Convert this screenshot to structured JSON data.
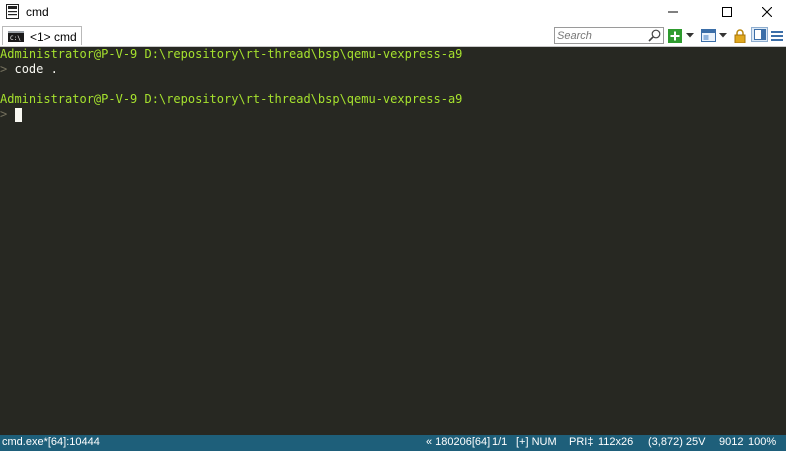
{
  "window": {
    "title": "cmd",
    "icons": {
      "app": "console-app-icon",
      "minimize": "minimize-icon",
      "maximize": "maximize-icon",
      "close": "close-icon"
    }
  },
  "tabs": [
    {
      "label": "<1> cmd",
      "icon": "console-icon",
      "active": true
    }
  ],
  "search": {
    "placeholder": "Search",
    "icon": "search-icon"
  },
  "toolbar": {
    "icons": [
      "add-console-icon",
      "dropdown-arrow-icon",
      "view-icon",
      "dropdown-arrow-icon",
      "lock-icon",
      "split-pane-icon",
      "menu-icon"
    ]
  },
  "terminal": {
    "lines": [
      {
        "user": "Administrator@P-V-9",
        "path": "D:\\repository\\rt-thread\\bsp\\qemu-vexpress-a9"
      },
      {
        "prompt": ">",
        "command": "code ."
      },
      {
        "user": "Administrator@P-V-9",
        "path": "D:\\repository\\rt-thread\\bsp\\qemu-vexpress-a9"
      },
      {
        "prompt": ">",
        "command": ""
      }
    ]
  },
  "statusbar": {
    "process": "cmd.exe*[64]:10444",
    "version": "« 180206[64]",
    "console": "1/1",
    "mode": "[+] NUM",
    "priority": "PRI‡",
    "size": "112x26",
    "cursor": "(3,872) 25V",
    "pid": "9012",
    "zoom": "100%"
  },
  "colors": {
    "terminal_bg": "#272822",
    "prompt_green": "#a6e22e",
    "text": "#f8f8f2",
    "statusbar_bg": "#1e5f7a"
  }
}
